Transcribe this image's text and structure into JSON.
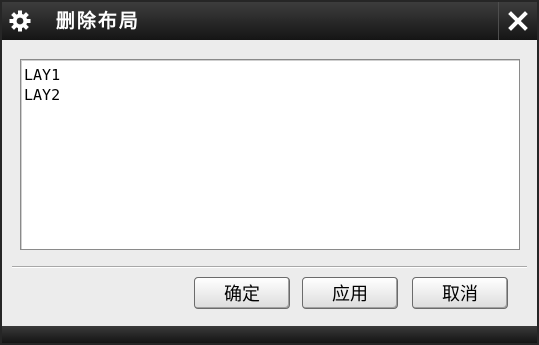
{
  "window": {
    "title": "删除布局",
    "title_icon": "gear-icon",
    "close_icon": "close-icon"
  },
  "layouts": {
    "items": [
      "LAY1",
      "LAY2"
    ]
  },
  "buttons": {
    "ok": "确定",
    "apply": "应用",
    "cancel": "取消"
  },
  "colors": {
    "titlebar": "#1c1c1c",
    "dialog_bg": "#ececec"
  }
}
